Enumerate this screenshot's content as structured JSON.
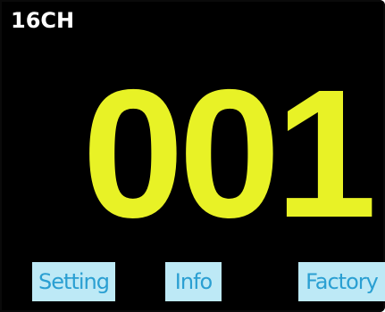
{
  "header": {
    "channel_label": "16CH"
  },
  "main": {
    "channel_number": "001"
  },
  "footer": {
    "setting_label": "Setting",
    "info_label": "Info",
    "factory_label": "Factory"
  },
  "colors": {
    "background": "#000000",
    "number": "#e8f226",
    "button_bg": "#bde9f6",
    "button_text": "#2a9fd2",
    "label": "#ffffff"
  }
}
